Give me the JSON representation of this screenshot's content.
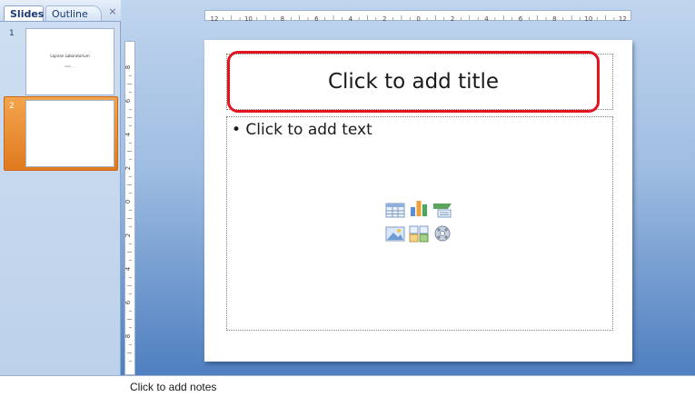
{
  "pane": {
    "tabs": [
      {
        "label": "Slides",
        "active": true
      },
      {
        "label": "Outline",
        "active": false
      }
    ],
    "close_glyph": "×",
    "close_icon": "close-icon"
  },
  "thumbnails": [
    {
      "number": "1",
      "title": "Lapiran Laboratorium",
      "subtitle": "Oleh: ...",
      "selected": false
    },
    {
      "number": "2",
      "title": "",
      "subtitle": "",
      "selected": true
    }
  ],
  "slide": {
    "title_placeholder": "Click to add title",
    "body_placeholder": "• Click to add text",
    "content_icons": [
      "insert-table-icon",
      "insert-chart-icon",
      "insert-smartart-icon",
      "insert-picture-icon",
      "insert-clipart-icon",
      "insert-media-icon"
    ]
  },
  "rulers": {
    "horizontal_labels": [
      "12",
      "10",
      "8",
      "6",
      "4",
      "2",
      "0",
      "2",
      "4",
      "6",
      "8",
      "10",
      "12"
    ],
    "vertical_labels": [
      "8",
      "6",
      "4",
      "2",
      "0",
      "2",
      "4",
      "6",
      "8"
    ]
  },
  "notes": {
    "placeholder": "Click to add notes"
  },
  "colors": {
    "selection_orange": "#e07a1f",
    "highlight_red": "#e1141f",
    "background_blue": "#4f7fc0"
  }
}
